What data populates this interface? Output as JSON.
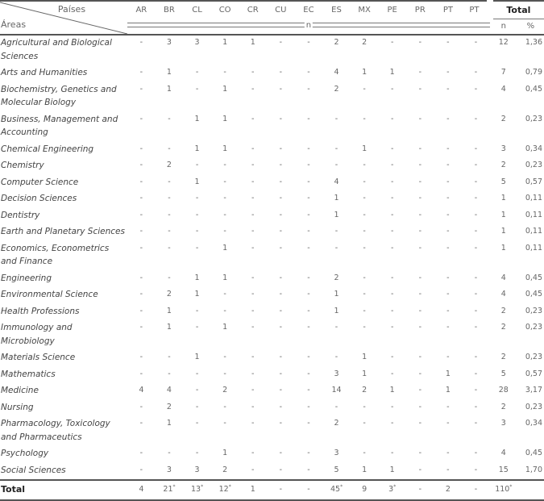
{
  "header": {
    "corner_top": "Países",
    "corner_bottom": "Áreas",
    "countries": [
      "AR",
      "BR",
      "CL",
      "CO",
      "CR",
      "CU",
      "EC",
      "ES",
      "MX",
      "PE",
      "PR",
      "PT",
      "PT"
    ],
    "n_label": "n",
    "total_label": "Total",
    "total_n": "n",
    "total_pct": "%"
  },
  "rows": [
    {
      "area": "Agricultural and Biological Sciences",
      "values": [
        "-",
        "3",
        "3",
        "1",
        "1",
        "-",
        "-",
        "2",
        "2",
        "-",
        "-",
        "-",
        "-"
      ],
      "n": "12",
      "pct": "1,36"
    },
    {
      "area": "Arts and Humanities",
      "values": [
        "-",
        "1",
        "-",
        "-",
        "-",
        "-",
        "-",
        "4",
        "1",
        "1",
        "-",
        "-",
        "-"
      ],
      "n": "7",
      "pct": "0,79"
    },
    {
      "area": "Biochemistry, Genetics and Molecular Biology",
      "values": [
        "-",
        "1",
        "-",
        "1",
        "-",
        "-",
        "-",
        "2",
        "-",
        "-",
        "-",
        "-",
        "-"
      ],
      "n": "4",
      "pct": "0,45"
    },
    {
      "area": "Business, Management and Accounting",
      "values": [
        "-",
        "-",
        "1",
        "1",
        "-",
        "-",
        "-",
        "-",
        "-",
        "-",
        "-",
        "-",
        "-"
      ],
      "n": "2",
      "pct": "0,23"
    },
    {
      "area": "Chemical Engineering",
      "values": [
        "-",
        "-",
        "1",
        "1",
        "-",
        "-",
        "-",
        "-",
        "1",
        "-",
        "-",
        "-",
        "-"
      ],
      "n": "3",
      "pct": "0,34"
    },
    {
      "area": "Chemistry",
      "values": [
        "-",
        "2",
        "-",
        "-",
        "-",
        "-",
        "-",
        "-",
        "-",
        "-",
        "-",
        "-",
        "-"
      ],
      "n": "2",
      "pct": "0,23"
    },
    {
      "area": "Computer Science",
      "values": [
        "-",
        "-",
        "1",
        "-",
        "-",
        "-",
        "-",
        "4",
        "-",
        "-",
        "-",
        "-",
        "-"
      ],
      "n": "5",
      "pct": "0,57"
    },
    {
      "area": "Decision Sciences",
      "values": [
        "-",
        "-",
        "-",
        "-",
        "-",
        "-",
        "-",
        "1",
        "-",
        "-",
        "-",
        "-",
        "-"
      ],
      "n": "1",
      "pct": "0,11"
    },
    {
      "area": "Dentistry",
      "values": [
        "-",
        "-",
        "-",
        "-",
        "-",
        "-",
        "-",
        "1",
        "-",
        "-",
        "-",
        "-",
        "-"
      ],
      "n": "1",
      "pct": "0,11"
    },
    {
      "area": "Earth and Planetary Sciences",
      "values": [
        "-",
        "-",
        "-",
        "-",
        "-",
        "-",
        "-",
        "-",
        "-",
        "-",
        "-",
        "-",
        "-"
      ],
      "n": "1",
      "pct": "0,11"
    },
    {
      "area": "Economics, Econometrics and Finance",
      "values": [
        "-",
        "-",
        "-",
        "1",
        "-",
        "-",
        "-",
        "-",
        "-",
        "-",
        "-",
        "-",
        "-"
      ],
      "n": "1",
      "pct": "0,11"
    },
    {
      "area": "Engineering",
      "values": [
        "-",
        "-",
        "1",
        "1",
        "-",
        "-",
        "-",
        "2",
        "-",
        "-",
        "-",
        "-",
        "-"
      ],
      "n": "4",
      "pct": "0,45"
    },
    {
      "area": "Environmental Science",
      "values": [
        "-",
        "2",
        "1",
        "-",
        "-",
        "-",
        "-",
        "1",
        "-",
        "-",
        "-",
        "-",
        "-"
      ],
      "n": "4",
      "pct": "0,45"
    },
    {
      "area": "Health Professions",
      "values": [
        "-",
        "1",
        "-",
        "-",
        "-",
        "-",
        "-",
        "1",
        "-",
        "-",
        "-",
        "-",
        "-"
      ],
      "n": "2",
      "pct": "0,23"
    },
    {
      "area": "Immunology and Microbiology",
      "values": [
        "-",
        "1",
        "-",
        "1",
        "-",
        "-",
        "-",
        "-",
        "-",
        "-",
        "-",
        "-",
        "-"
      ],
      "n": "2",
      "pct": "0,23"
    },
    {
      "area": "Materials Science",
      "values": [
        "-",
        "-",
        "1",
        "-",
        "-",
        "-",
        "-",
        "-",
        "1",
        "-",
        "-",
        "-",
        "-"
      ],
      "n": "2",
      "pct": "0,23"
    },
    {
      "area": "Mathematics",
      "values": [
        "-",
        "-",
        "-",
        "-",
        "-",
        "-",
        "-",
        "3",
        "1",
        "-",
        "-",
        "1",
        "-"
      ],
      "n": "5",
      "pct": "0,57"
    },
    {
      "area": "Medicine",
      "values": [
        "4",
        "4",
        "-",
        "2",
        "-",
        "-",
        "-",
        "14",
        "2",
        "1",
        "-",
        "1",
        "-"
      ],
      "n": "28",
      "pct": "3,17"
    },
    {
      "area": "Nursing",
      "values": [
        "-",
        "2",
        "-",
        "-",
        "-",
        "-",
        "-",
        "-",
        "-",
        "-",
        "-",
        "-",
        "-"
      ],
      "n": "2",
      "pct": "0,23"
    },
    {
      "area": "Pharmacology, Toxicology and Pharmaceutics",
      "values": [
        "-",
        "1",
        "-",
        "-",
        "-",
        "-",
        "-",
        "2",
        "-",
        "-",
        "-",
        "-",
        "-"
      ],
      "n": "3",
      "pct": "0,34"
    },
    {
      "area": "Psychology",
      "values": [
        "-",
        "-",
        "-",
        "1",
        "-",
        "-",
        "-",
        "3",
        "-",
        "-",
        "-",
        "-",
        "-"
      ],
      "n": "4",
      "pct": "0,45"
    },
    {
      "area": "Social Sciences",
      "values": [
        "-",
        "3",
        "3",
        "2",
        "-",
        "-",
        "-",
        "5",
        "1",
        "1",
        "-",
        "-",
        "-"
      ],
      "n": "15",
      "pct": "1,70"
    }
  ],
  "total": {
    "label": "Total",
    "values": [
      "4",
      "21*",
      "13*",
      "12*",
      "1",
      "-",
      "-",
      "45*",
      "9",
      "3*",
      "-",
      "2",
      "-"
    ],
    "n": "110*",
    "pct": ""
  }
}
